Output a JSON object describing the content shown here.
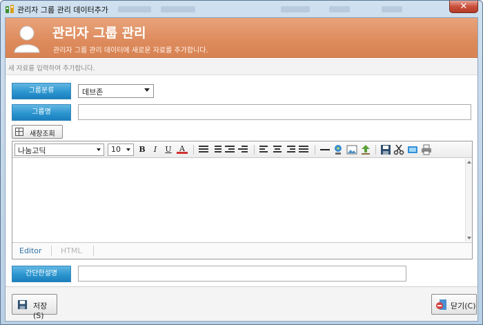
{
  "window": {
    "title": "관리자 그룹 관리 데이터추가",
    "close_label": "✕"
  },
  "header": {
    "title": "관리자 그룹 관리",
    "subtitle": "관리자 그룹 관리 데이터에 새로운 자료를 추가합니다."
  },
  "hint": "새 자료를 입력하여 추가합니다.",
  "form": {
    "category_label": "그룹분류",
    "category_value": "데브존",
    "group_name_label": "그룹명",
    "group_name_value": "",
    "description_label": "간단한설명",
    "description_value": ""
  },
  "new_window_button": "새창조회",
  "editor": {
    "font": "나눔고딕",
    "size": "10",
    "tab_editor": "Editor",
    "tab_html": "HTML",
    "toolbar": [
      "bold",
      "italic",
      "underline",
      "font-color",
      "ordered-list",
      "unordered-list",
      "outdent",
      "indent",
      "align-left",
      "align-center",
      "align-right",
      "align-justify",
      "horizontal-rule",
      "link",
      "image",
      "upload",
      "save",
      "cut",
      "flash",
      "print"
    ],
    "bold_glyph": "B",
    "italic_glyph": "I",
    "underline_glyph": "U",
    "color_glyph": "A"
  },
  "buttons": {
    "save": "저장(S)",
    "close": "닫기(C)"
  }
}
